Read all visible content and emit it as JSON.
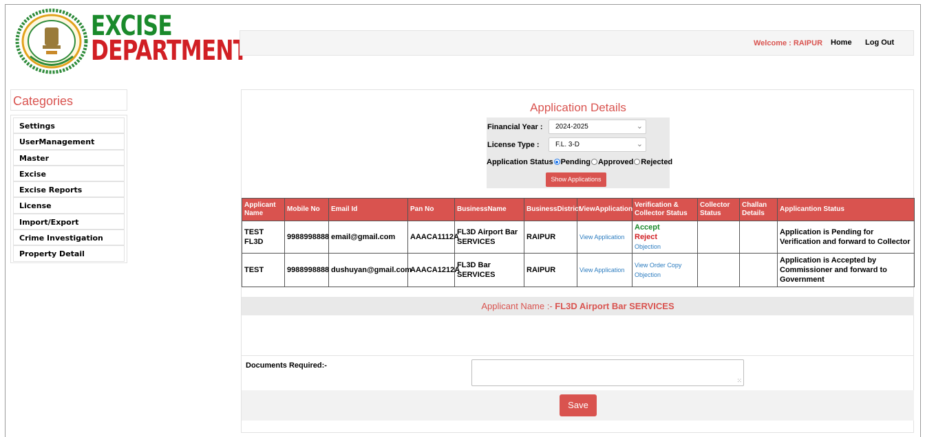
{
  "logo": {
    "line1": "EXCISE",
    "line2": "DEPARTMENT"
  },
  "header": {
    "welcome": "Welcome : RAIPUR",
    "home": "Home",
    "logout": "Log Out"
  },
  "sidebar": {
    "title": "Categories",
    "items": [
      {
        "label": "Settings"
      },
      {
        "label": "UserManagement"
      },
      {
        "label": "Master"
      },
      {
        "label": "Excise"
      },
      {
        "label": "Excise Reports"
      },
      {
        "label": "License"
      },
      {
        "label": "Import/Export"
      },
      {
        "label": "Crime Investigation"
      },
      {
        "label": "Property Detail"
      }
    ]
  },
  "main": {
    "title": "Application Details",
    "filters": {
      "financial_year_label": "Financial Year :",
      "financial_year_value": "2024-2025",
      "license_type_label": "License Type :",
      "license_type_value": "F.L. 3-D",
      "status_label": "Application Status",
      "status_options": [
        "Pending",
        "Approved",
        "Rejected"
      ],
      "status_selected": "Pending",
      "show_button": "Show Applications"
    },
    "table": {
      "headers": [
        "Applicant Name",
        "Mobile No",
        "Email Id",
        "Pan No",
        "BusinessName",
        "BusinessDistrict",
        "ViewApplication",
        "Verification & Collector Status",
        "Collector Status",
        "Challan Details",
        "Applicantion Status"
      ],
      "rows": [
        {
          "name": "TEST FL3D",
          "mobile": "9988998888",
          "email": "email@gmail.com",
          "pan": "AAACA1112A",
          "business": "FL3D Airport Bar SERVICES",
          "district": "RAIPUR",
          "view": "View Application",
          "verify": [
            "Accept",
            "Reject",
            "Objection"
          ],
          "collector": "",
          "challan": "",
          "status": "Application is Pending for Verification and forward to Collector"
        },
        {
          "name": "TEST",
          "mobile": "9988998888",
          "email": "dushuyan@gmail.com",
          "pan": "AAACA1212A",
          "business": "FL3D Bar SERVICES",
          "district": "RAIPUR",
          "view": "View Application",
          "verify": [
            "View Order Copy",
            "Objection"
          ],
          "collector": "",
          "challan": "",
          "status": "Application is Accepted by Commissioner and forward to Government"
        }
      ]
    },
    "applicant_prefix": "Applicant Name :- ",
    "applicant_name": "FL3D Airport Bar SERVICES",
    "documents_label": "Documents Required:-",
    "save_button": "Save"
  },
  "colors": {
    "accent": "#d9534f",
    "link": "#2a7bbf",
    "green": "#1a8a2b"
  },
  "icons": {
    "select_arrow": "chevron-down-icon",
    "logo_seal": "emblem-seal-icon"
  }
}
